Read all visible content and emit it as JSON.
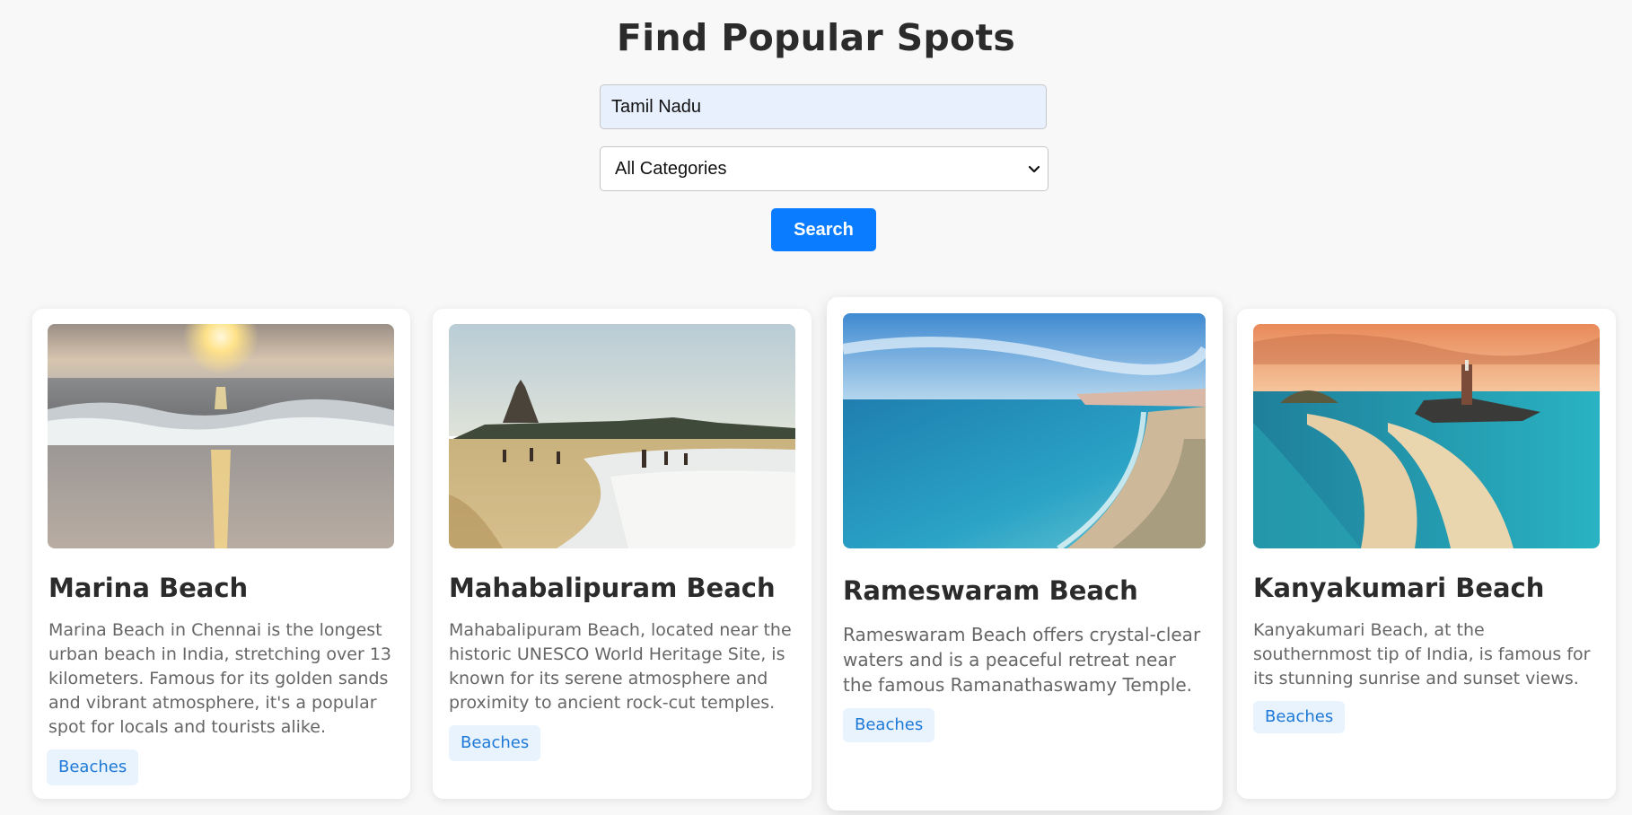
{
  "page": {
    "title": "Find Popular Spots"
  },
  "search": {
    "value": "Tamil Nadu",
    "button_label": "Search"
  },
  "category": {
    "selected": "All Categories"
  },
  "colors": {
    "accent": "#0a7cff",
    "tag_bg": "#e8f3fd",
    "tag_text": "#1d78d6",
    "input_bg": "#e8f0fe"
  },
  "spots": [
    {
      "name": "Marina Beach",
      "description": "Marina Beach in Chennai is the longest urban beach in India, stretching over 13 kilometers. Famous for its golden sands and vibrant atmosphere, it's a popular spot for locals and tourists alike.",
      "category": "Beaches"
    },
    {
      "name": "Mahabalipuram Beach",
      "description": "Mahabalipuram Beach, located near the historic UNESCO World Heritage Site, is known for its serene atmosphere and proximity to ancient rock-cut temples.",
      "category": "Beaches"
    },
    {
      "name": "Rameswaram Beach",
      "description": "Rameswaram Beach offers crystal-clear waters and is a peaceful retreat near the famous Ramanathaswamy Temple.",
      "category": "Beaches"
    },
    {
      "name": "Kanyakumari Beach",
      "description": "Kanyakumari Beach, at the southernmost tip of India, is famous for its stunning sunrise and sunset views.",
      "category": "Beaches"
    }
  ]
}
